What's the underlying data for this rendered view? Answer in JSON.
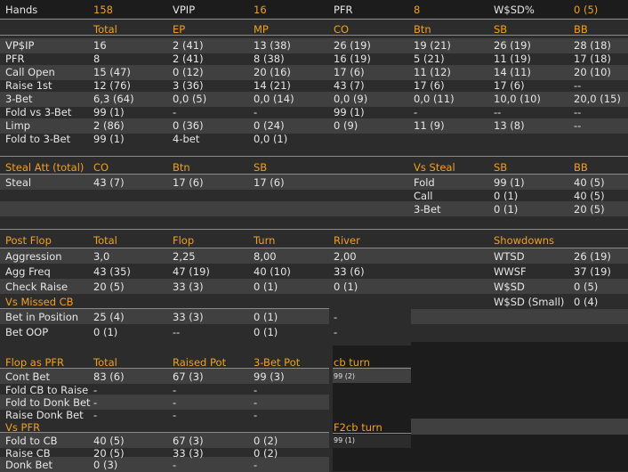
{
  "summary": {
    "hands_label": "Hands",
    "hands": "158",
    "vpip_label": "VPIP",
    "vpip": "16",
    "pfr_label": "PFR",
    "pfr": "8",
    "wsd_label": "W$SD%",
    "wsd": "0 (5)"
  },
  "positional": {
    "headers": [
      "Total",
      "EP",
      "MP",
      "CO",
      "Btn",
      "SB",
      "BB"
    ],
    "rows": [
      {
        "label": "VP$IP",
        "cells": [
          "16",
          "2 (41)",
          "13 (38)",
          "26 (19)",
          "19 (21)",
          "26 (19)",
          "28 (18)"
        ]
      },
      {
        "label": "PFR",
        "cells": [
          "8",
          "2 (41)",
          "8 (38)",
          "16 (19)",
          "5 (21)",
          "11 (19)",
          "17 (18)"
        ]
      },
      {
        "label": "Call Open",
        "cells": [
          "15 (47)",
          "0 (12)",
          "20 (16)",
          "17 (6)",
          "11 (12)",
          "14 (11)",
          "20 (10)"
        ]
      },
      {
        "label": "Raise 1st",
        "cells": [
          "12 (76)",
          "3 (36)",
          "14 (21)",
          "43 (7)",
          "17 (6)",
          "17 (6)",
          "--"
        ]
      },
      {
        "label": "3-Bet",
        "cells": [
          "6,3 (64)",
          "0,0 (5)",
          "0,0 (14)",
          "0,0 (9)",
          "0,0 (11)",
          "10,0 (10)",
          "20,0 (15)"
        ]
      },
      {
        "label": "Fold vs 3-Bet",
        "cells": [
          "99 (1)",
          "-",
          "-",
          "99 (1)",
          "-",
          "--",
          "--"
        ]
      },
      {
        "label": "Limp",
        "cells": [
          "2 (86)",
          "0 (36)",
          "0 (24)",
          "0 (9)",
          "11 (9)",
          "13 (8)",
          "--"
        ]
      },
      {
        "label": "Fold to 3-Bet",
        "cells": [
          "99 (1)",
          "4-bet",
          "0,0 (1)",
          "",
          "",
          "",
          ""
        ]
      }
    ]
  },
  "steal": {
    "title": "Steal Att (total)",
    "headers": [
      "CO",
      "Btn",
      "SB"
    ],
    "row_label": "Steal",
    "cells": [
      "43 (7)",
      "17 (6)",
      "17 (6)"
    ],
    "vs_title": "Vs Steal",
    "vs_headers": [
      "SB",
      "BB"
    ],
    "vs_rows": [
      {
        "label": "Fold",
        "cells": [
          "99 (1)",
          "40 (5)"
        ]
      },
      {
        "label": "Call",
        "cells": [
          "0 (1)",
          "40 (5)"
        ]
      },
      {
        "label": "3-Bet",
        "cells": [
          "0 (1)",
          "20 (5)"
        ]
      }
    ]
  },
  "postflop": {
    "title": "Post Flop",
    "headers": [
      "Total",
      "Flop",
      "Turn",
      "River"
    ],
    "rows": [
      {
        "label": "Aggression",
        "cells": [
          "3,0",
          "2,25",
          "8,00",
          "2,00"
        ]
      },
      {
        "label": "Agg Freq",
        "cells": [
          "43 (35)",
          "47 (19)",
          "40 (10)",
          "33 (6)"
        ]
      },
      {
        "label": "Check Raise",
        "cells": [
          "20 (5)",
          "33 (3)",
          "0 (1)",
          "0 (1)"
        ]
      }
    ],
    "missed_title": "Vs Missed CB",
    "missed_rows": [
      {
        "label": "Bet in Position",
        "cells": [
          "25 (4)",
          "33 (3)",
          "0 (1)",
          "-"
        ]
      },
      {
        "label": "Bet OOP",
        "cells": [
          "0 (1)",
          "--",
          "0 (1)",
          "-"
        ]
      }
    ],
    "showdowns_title": "Showdowns",
    "showdowns": [
      {
        "label": "WTSD",
        "value": "26 (19)"
      },
      {
        "label": "WWSF",
        "value": "37 (19)"
      },
      {
        "label": "W$SD",
        "value": "0 (5)"
      },
      {
        "label": "W$SD (Small)",
        "value": "0 (4)"
      }
    ]
  },
  "flop_pfr": {
    "title": "Flop as PFR",
    "headers": [
      "Total",
      "Raised Pot",
      "3-Bet Pot"
    ],
    "rows": [
      {
        "label": "Cont Bet",
        "cells": [
          "83 (6)",
          "67 (3)",
          "99 (3)"
        ]
      },
      {
        "label": "Fold CB to Raise",
        "cells": [
          "-",
          "-",
          "-"
        ]
      },
      {
        "label": "Fold to Donk Bet",
        "cells": [
          "-",
          "-",
          "-"
        ]
      },
      {
        "label": "Raise Donk Bet",
        "cells": [
          "-",
          "-",
          "-"
        ]
      }
    ],
    "vs_title": "Vs PFR",
    "vs_rows": [
      {
        "label": "Fold to CB",
        "cells": [
          "40 (5)",
          "67 (3)",
          "0 (2)"
        ]
      },
      {
        "label": "Raise CB",
        "cells": [
          "20 (5)",
          "33 (3)",
          "0 (2)"
        ]
      },
      {
        "label": "Donk Bet",
        "cells": [
          "0 (3)",
          "-",
          "-"
        ]
      }
    ],
    "cbturn_title": "cb turn",
    "cbturn_value": "99 (2)",
    "f2cb_title": "F2cb turn",
    "f2cb_value": "99 (1)"
  },
  "colors": {
    "background": "#2c2c2c",
    "band": "#404040",
    "accent": "#f0a020",
    "text": "#e6e6e6",
    "dark_block": "#1c1c1c"
  }
}
